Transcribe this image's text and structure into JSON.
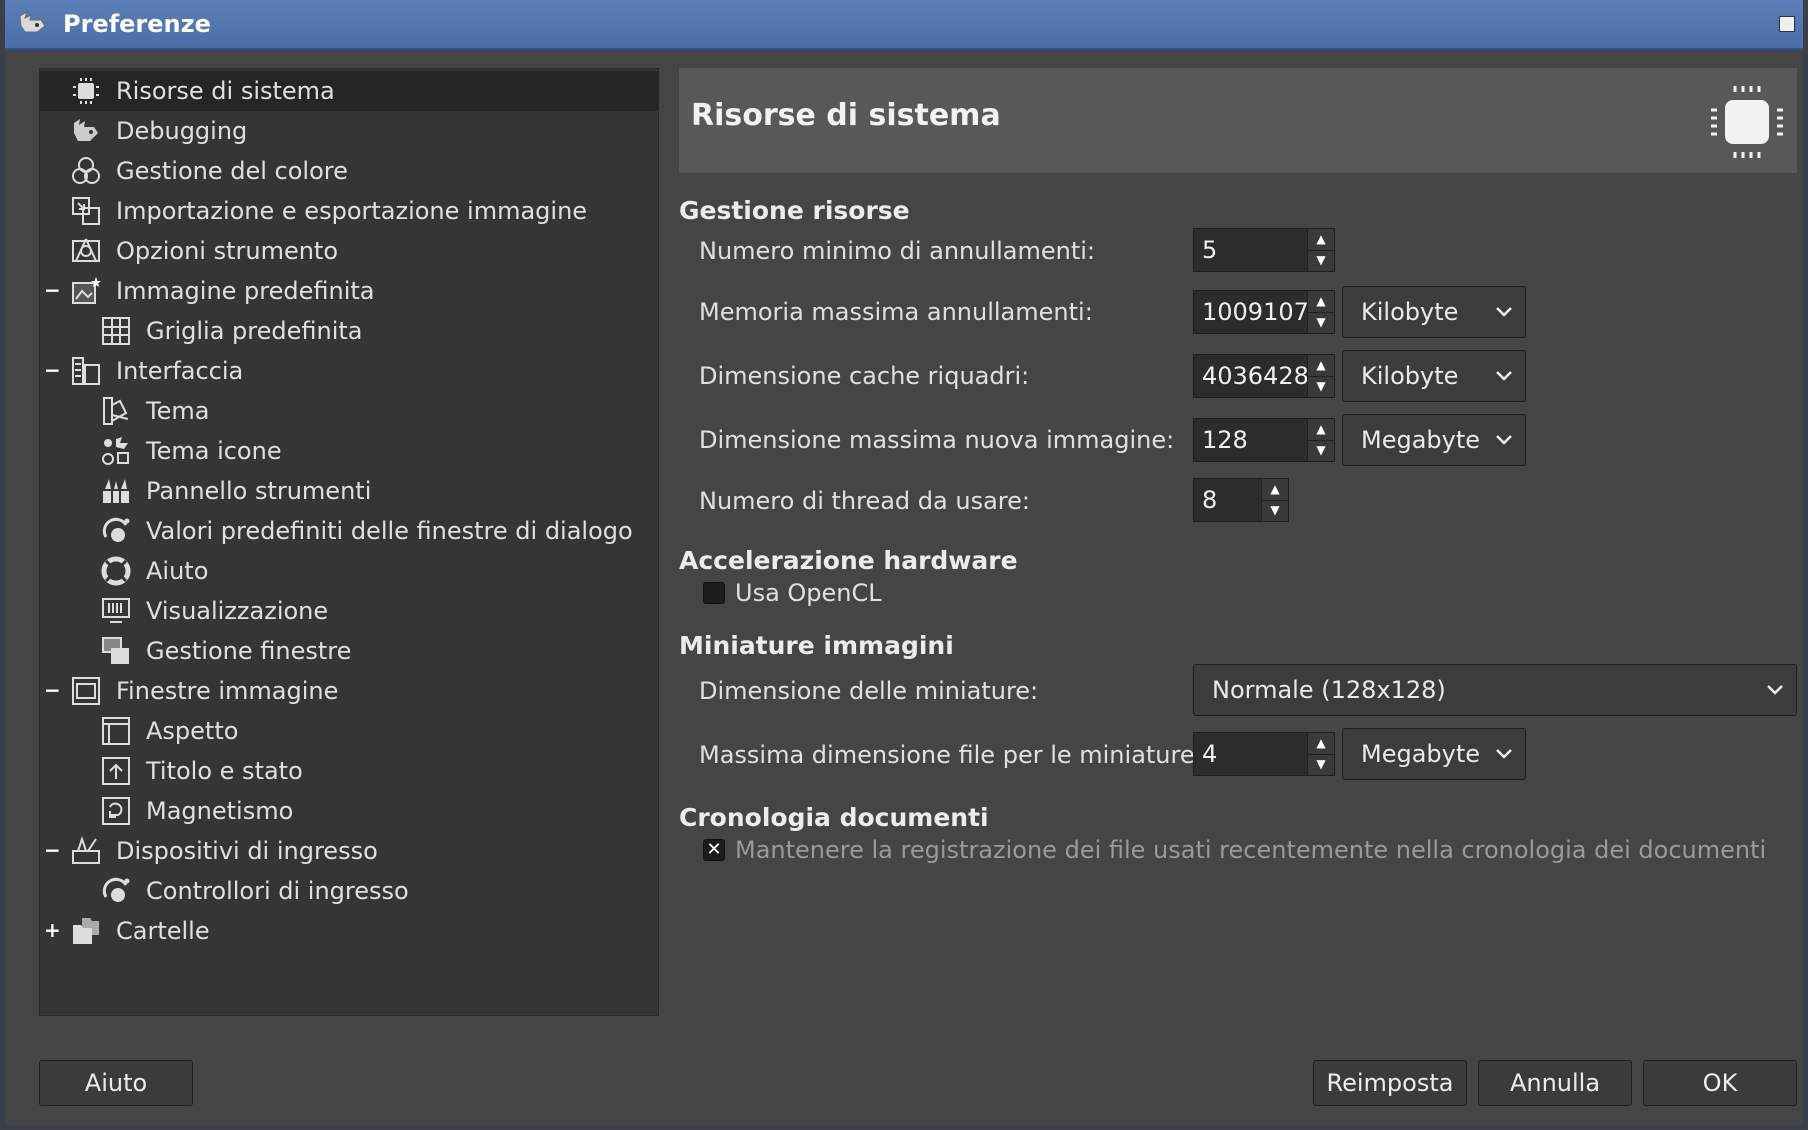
{
  "window": {
    "title": "Preferenze"
  },
  "sidebar": {
    "items": [
      {
        "label": "Risorse di sistema",
        "icon": "chip-icon",
        "selected": true
      },
      {
        "label": "Debugging",
        "icon": "wilber-icon"
      },
      {
        "label": "Gestione del colore",
        "icon": "color-circles-icon"
      },
      {
        "label": "Importazione e esportazione immagine",
        "icon": "import-export-icon"
      },
      {
        "label": "Opzioni strumento",
        "icon": "tool-options-icon"
      },
      {
        "label": "Immagine predefinita",
        "icon": "default-image-icon",
        "expander": "−"
      },
      {
        "label": "Griglia predefinita",
        "icon": "grid-icon"
      },
      {
        "label": "Interfaccia",
        "icon": "interface-icon",
        "expander": "−"
      },
      {
        "label": "Tema",
        "icon": "theme-icon"
      },
      {
        "label": "Tema icone",
        "icon": "icon-theme-icon"
      },
      {
        "label": "Pannello strumenti",
        "icon": "toolbox-icon"
      },
      {
        "label": "Valori predefiniti delle finestre di dialogo",
        "icon": "dial-icon"
      },
      {
        "label": "Aiuto",
        "icon": "help-ring-icon"
      },
      {
        "label": "Visualizzazione",
        "icon": "display-icon"
      },
      {
        "label": "Gestione finestre",
        "icon": "windows-icon"
      },
      {
        "label": "Finestre immagine",
        "icon": "image-window-icon",
        "expander": "−"
      },
      {
        "label": "Aspetto",
        "icon": "appearance-icon"
      },
      {
        "label": "Titolo e stato",
        "icon": "title-status-icon"
      },
      {
        "label": "Magnetismo",
        "icon": "snap-icon"
      },
      {
        "label": "Dispositivi di ingresso",
        "icon": "input-devices-icon",
        "expander": "−"
      },
      {
        "label": "Controllori di ingresso",
        "icon": "dial-icon"
      },
      {
        "label": "Cartelle",
        "icon": "folders-icon",
        "expander": "+"
      }
    ]
  },
  "header": {
    "title": "Risorse di sistema",
    "icon": "chip-icon"
  },
  "sections": {
    "resources": {
      "title": "Gestione risorse",
      "undo_min_label": "Numero minimo di annullamenti:",
      "undo_min_value": "5",
      "undo_mem_label": "Memoria massima annullamenti:",
      "undo_mem_value": "1009107",
      "undo_mem_unit": "Kilobyte",
      "tile_cache_label": "Dimensione cache riquadri:",
      "tile_cache_value": "4036428",
      "tile_cache_unit": "Kilobyte",
      "max_image_label": "Dimensione massima nuova immagine:",
      "max_image_value": "128",
      "max_image_unit": "Megabyte",
      "threads_label": "Numero di thread da usare:",
      "threads_value": "8"
    },
    "hardware": {
      "title": "Accelerazione hardware",
      "opencl_label": "Usa OpenCL",
      "opencl_checked": false
    },
    "thumbnails": {
      "title": "Miniature immagini",
      "size_label": "Dimensione delle miniature:",
      "size_value": "Normale (128x128)",
      "filesize_label": "Massima dimensione file per le miniature:",
      "filesize_value": "4",
      "filesize_unit": "Megabyte"
    },
    "history": {
      "title": "Cronologia documenti",
      "keep_label": "Mantenere la registrazione dei file usati recentemente nella cronologia dei documenti",
      "keep_checked": true
    }
  },
  "buttons": {
    "help": "Aiuto",
    "reset": "Reimposta",
    "cancel": "Annulla",
    "ok": "OK"
  },
  "colors": {
    "titlebar": "#4a6ea8",
    "background": "#454545",
    "panel": "#353535"
  }
}
